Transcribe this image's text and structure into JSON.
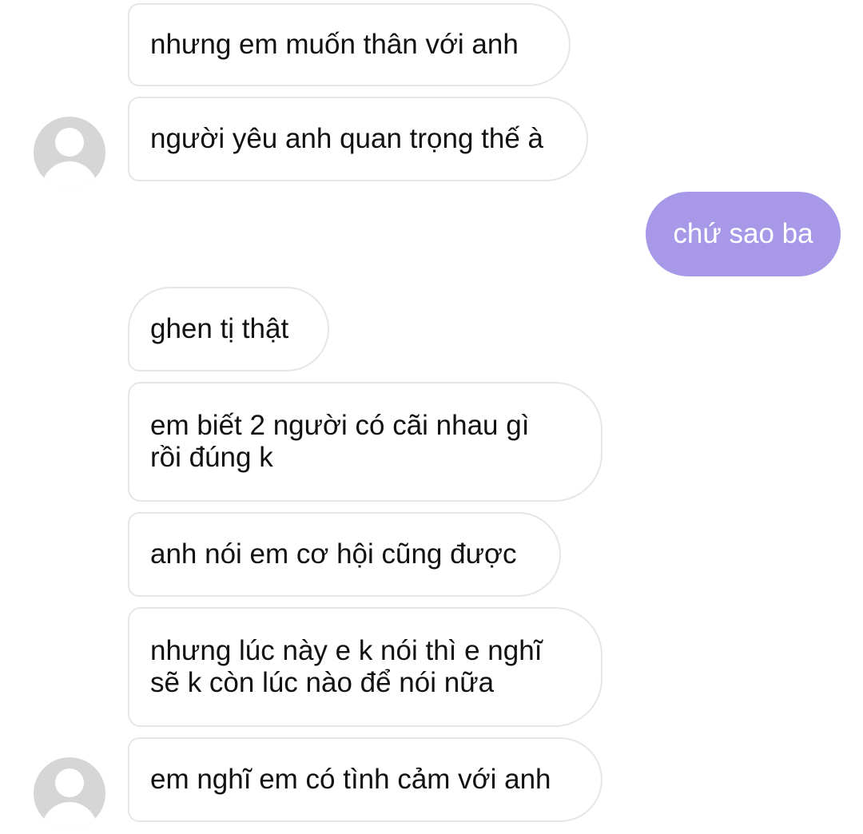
{
  "conversation": {
    "messages": [
      {
        "sender": "other",
        "text": "nhưng em muốn thân với anh"
      },
      {
        "sender": "other",
        "text": "người yêu anh quan trọng thế à"
      },
      {
        "sender": "me",
        "text": "chứ sao ba"
      },
      {
        "sender": "other",
        "text": "ghen tị thật"
      },
      {
        "sender": "other",
        "text": "em biết 2 người có cãi nhau gì\nrồi đúng k"
      },
      {
        "sender": "other",
        "text": "anh nói em cơ hội cũng được"
      },
      {
        "sender": "other",
        "text": "nhưng lúc này e k nói thì e nghĩ\nsẽ k còn lúc nào để nói nữa"
      },
      {
        "sender": "other",
        "text": "em nghĩ em có tình cảm với anh"
      }
    ]
  },
  "avatar_icon": "default-user-avatar-icon",
  "colors": {
    "outgoing_bubble": "#a898e8",
    "incoming_bubble_border": "#e6e6e6",
    "avatar_placeholder": "#d6d6d6"
  }
}
